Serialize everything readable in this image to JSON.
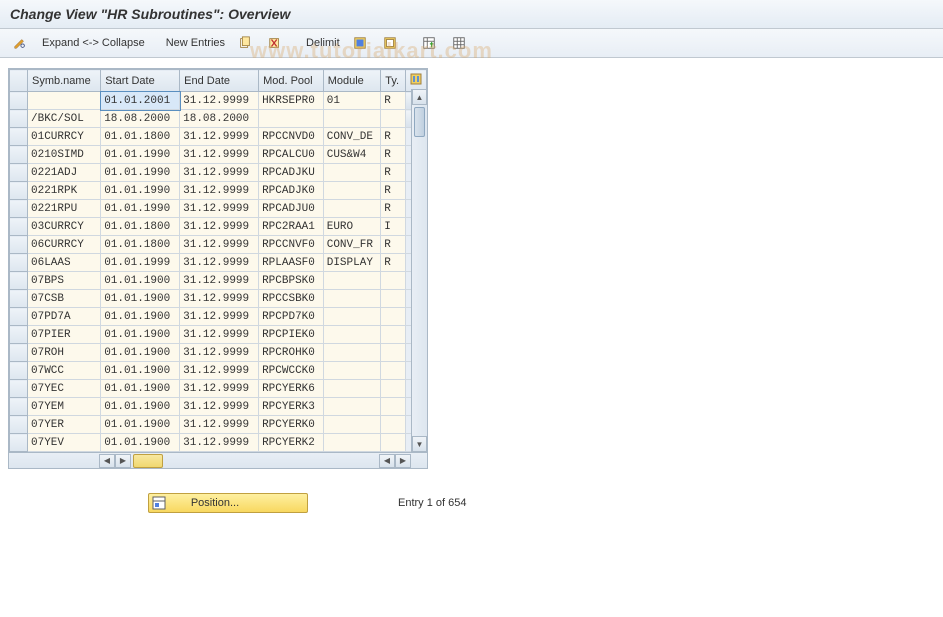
{
  "title": "Change View \"HR Subroutines\": Overview",
  "watermark": "www.tutorialkart.com",
  "toolbar": {
    "expand_collapse": "Expand <-> Collapse",
    "new_entries": "New Entries",
    "delimit": "Delimit"
  },
  "table": {
    "headers": {
      "symb_name": "Symb.name",
      "start_date": "Start Date",
      "end_date": "End Date",
      "mod_pool": "Mod. Pool",
      "module": "Module",
      "type": "Ty."
    },
    "rows": [
      {
        "symb": "",
        "start": "01.01.2001",
        "end": "31.12.9999",
        "pool": "HKRSEPR0",
        "module": "01",
        "type": "R",
        "selected": true
      },
      {
        "symb": "/BKC/SOL",
        "start": "18.08.2000",
        "end": "18.08.2000",
        "pool": "",
        "module": "",
        "type": ""
      },
      {
        "symb": "01CURRCY",
        "start": "01.01.1800",
        "end": "31.12.9999",
        "pool": "RPCCNVD0",
        "module": "CONV_DE",
        "type": "R"
      },
      {
        "symb": "0210SIMD",
        "start": "01.01.1990",
        "end": "31.12.9999",
        "pool": "RPCALCU0",
        "module": "CUS&W4",
        "type": "R"
      },
      {
        "symb": "0221ADJ",
        "start": "01.01.1990",
        "end": "31.12.9999",
        "pool": "RPCADJKU",
        "module": "",
        "type": "R"
      },
      {
        "symb": "0221RPK",
        "start": "01.01.1990",
        "end": "31.12.9999",
        "pool": "RPCADJK0",
        "module": "",
        "type": "R"
      },
      {
        "symb": "0221RPU",
        "start": "01.01.1990",
        "end": "31.12.9999",
        "pool": "RPCADJU0",
        "module": "",
        "type": "R"
      },
      {
        "symb": "03CURRCY",
        "start": "01.01.1800",
        "end": "31.12.9999",
        "pool": "RPC2RAA1",
        "module": "EURO",
        "type": "I"
      },
      {
        "symb": "06CURRCY",
        "start": "01.01.1800",
        "end": "31.12.9999",
        "pool": "RPCCNVF0",
        "module": "CONV_FR",
        "type": "R"
      },
      {
        "symb": "06LAAS",
        "start": "01.01.1999",
        "end": "31.12.9999",
        "pool": "RPLAASF0",
        "module": "DISPLAY",
        "type": "R"
      },
      {
        "symb": "07BPS",
        "start": "01.01.1900",
        "end": "31.12.9999",
        "pool": "RPCBPSK0",
        "module": "",
        "type": ""
      },
      {
        "symb": "07CSB",
        "start": "01.01.1900",
        "end": "31.12.9999",
        "pool": "RPCCSBK0",
        "module": "",
        "type": ""
      },
      {
        "symb": "07PD7A",
        "start": "01.01.1900",
        "end": "31.12.9999",
        "pool": "RPCPD7K0",
        "module": "",
        "type": ""
      },
      {
        "symb": "07PIER",
        "start": "01.01.1900",
        "end": "31.12.9999",
        "pool": "RPCPIEK0",
        "module": "",
        "type": ""
      },
      {
        "symb": "07ROH",
        "start": "01.01.1900",
        "end": "31.12.9999",
        "pool": "RPCROHK0",
        "module": "",
        "type": ""
      },
      {
        "symb": "07WCC",
        "start": "01.01.1900",
        "end": "31.12.9999",
        "pool": "RPCWCCK0",
        "module": "",
        "type": ""
      },
      {
        "symb": "07YEC",
        "start": "01.01.1900",
        "end": "31.12.9999",
        "pool": "RPCYERK6",
        "module": "",
        "type": ""
      },
      {
        "symb": "07YEM",
        "start": "01.01.1900",
        "end": "31.12.9999",
        "pool": "RPCYERK3",
        "module": "",
        "type": ""
      },
      {
        "symb": "07YER",
        "start": "01.01.1900",
        "end": "31.12.9999",
        "pool": "RPCYERK0",
        "module": "",
        "type": ""
      },
      {
        "symb": "07YEV",
        "start": "01.01.1900",
        "end": "31.12.9999",
        "pool": "RPCYERK2",
        "module": "",
        "type": ""
      }
    ]
  },
  "footer": {
    "position_label": "Position...",
    "status": "Entry 1 of 654"
  }
}
